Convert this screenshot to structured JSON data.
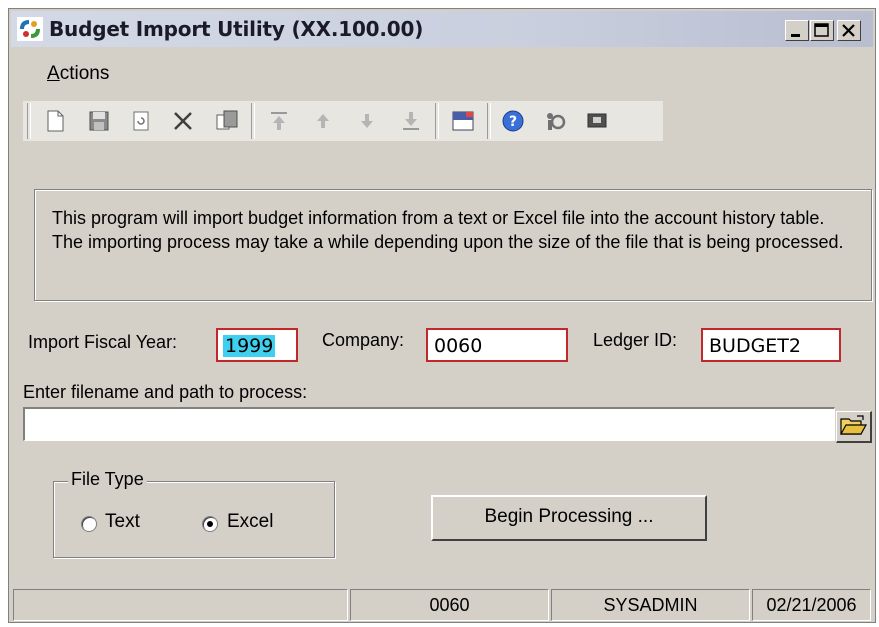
{
  "window": {
    "title": "Budget Import Utility (XX.100.00)"
  },
  "menu": {
    "actions_first": "A",
    "actions_rest": "ctions"
  },
  "toolbar": {
    "buttons": [
      "new-icon",
      "save-icon",
      "refresh-icon",
      "delete-icon",
      "copy-icon",
      "first-icon",
      "previous-icon",
      "next-icon",
      "last-icon",
      "note-icon",
      "help-icon",
      "customize-icon",
      "screen-icon"
    ]
  },
  "info": {
    "text": "This program will import budget information from a text or Excel file into the account history table.  The importing process may take a while depending upon the size of the file that is being processed."
  },
  "fields": {
    "fiscal_year_label": "Import Fiscal Year:",
    "fiscal_year_value": "1999",
    "company_label": "Company:",
    "company_value": "0060",
    "ledger_label": "Ledger ID:",
    "ledger_value": "BUDGET2",
    "path_label": "Enter filename and path to process:",
    "path_value": ""
  },
  "file_type": {
    "title": "File Type",
    "options": [
      "Text",
      "Excel"
    ],
    "selected": "Excel"
  },
  "begin_button": "Begin Processing ...",
  "status_bar": [
    "",
    "0060",
    "SYSADMIN",
    "02/21/2006"
  ],
  "colors": {
    "required_border": "#c0282a",
    "selection": "#3fd0ef",
    "face": "#d4d0c8"
  }
}
